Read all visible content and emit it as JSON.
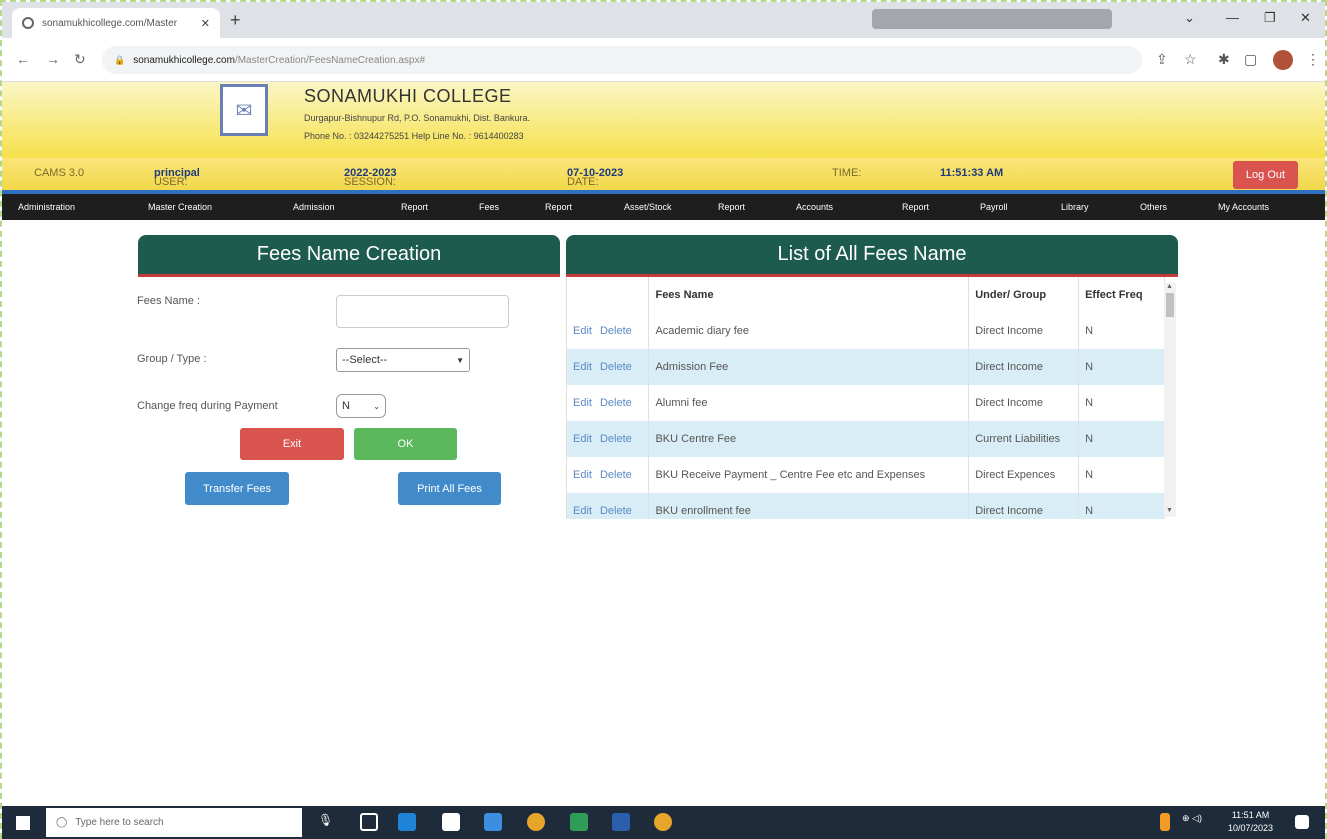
{
  "browser": {
    "tab_title": "sonamukhicollege.com/Master",
    "url_host": "sonamukhicollege.com",
    "url_path": "/MasterCreation/FeesNameCreation.aspx#"
  },
  "header": {
    "college_name": "SONAMUKHI COLLEGE",
    "address": "Durgapur-Bishnupur Rd, P.O. Sonamukhi, Dist. Bankura.",
    "phone": "Phone No. : 03244275251  Help Line No. : 9614400283"
  },
  "info_bar": {
    "system_label": "CAMS 3.0",
    "user_label": "USER:",
    "user_value": "principal",
    "session_label": "SESSION:",
    "session_value": "2022-2023",
    "date_label": "DATE:",
    "date_value": "07-10-2023",
    "time_label": "TIME:",
    "time_value": "11:51:33 AM",
    "logout": "Log Out"
  },
  "menu": [
    "Administration",
    "Master Creation",
    "Admission",
    "Report",
    "Fees",
    "Report",
    "Asset/Stock",
    "Report",
    "Accounts",
    "Report",
    "Payroll",
    "Library",
    "Others",
    "My Accounts"
  ],
  "form": {
    "title": "Fees Name Creation",
    "fees_name_label": "Fees Name :",
    "fees_name_value": "",
    "group_label": "Group / Type :",
    "group_value": "--Select--",
    "change_freq_label": "Change freq during Payment",
    "change_freq_value": "N",
    "exit_label": "Exit",
    "ok_label": "OK",
    "transfer_label": "Transfer Fees",
    "print_label": "Print All Fees"
  },
  "list": {
    "title": "List of All Fees Name",
    "columns": [
      "",
      "Fees Name",
      "Under/ Group",
      "Effect Freq"
    ],
    "edit_label": "Edit",
    "delete_label": "Delete",
    "rows": [
      {
        "name": "Academic diary fee",
        "group": "Direct Income",
        "freq": "N"
      },
      {
        "name": "Admission Fee",
        "group": "Direct Income",
        "freq": "N"
      },
      {
        "name": "Alumni fee",
        "group": "Direct Income",
        "freq": "N"
      },
      {
        "name": "BKU Centre Fee",
        "group": "Current Liabilities",
        "freq": "N"
      },
      {
        "name": "BKU Receive Payment _ Centre Fee etc and Expenses",
        "group": "Direct Expences",
        "freq": "N"
      },
      {
        "name": "BKU enrollment fee",
        "group": "Direct Income",
        "freq": "N"
      }
    ]
  },
  "taskbar": {
    "search_placeholder": "Type here to search",
    "time": "11:51 AM",
    "date": "10/07/2023"
  }
}
